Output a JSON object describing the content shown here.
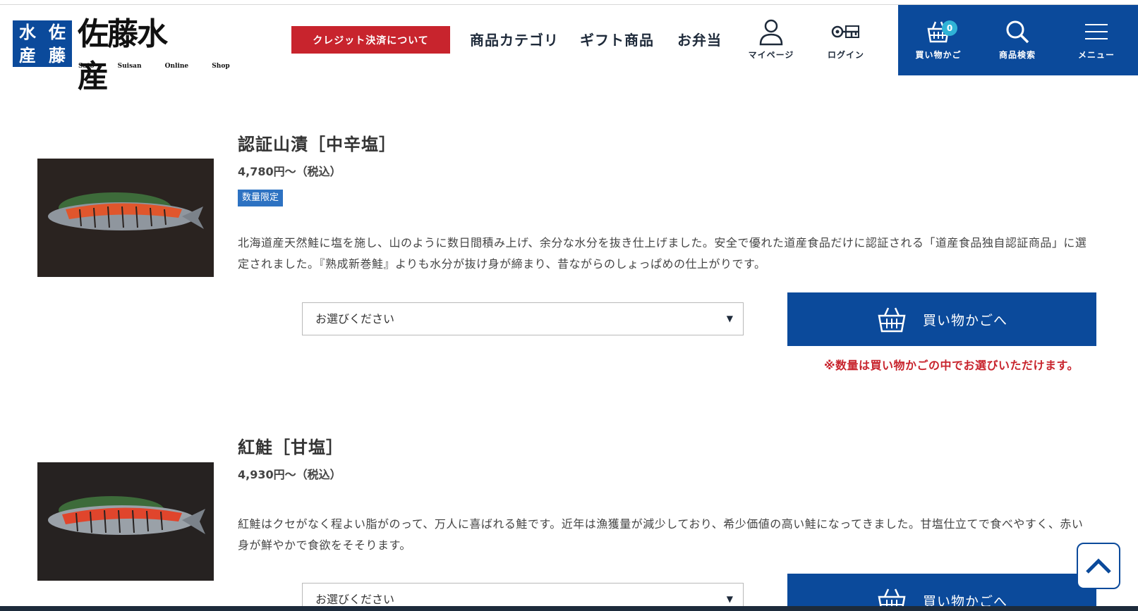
{
  "header": {
    "logo": {
      "mark_chars": [
        "水",
        "佐",
        "産",
        "藤"
      ],
      "script": "佐藤水産",
      "sub": "Sato Suisan Online Shop"
    },
    "credit_button": "クレジット決済について",
    "nav": [
      "商品カテゴリ",
      "ギフト商品",
      "お弁当"
    ],
    "icons": {
      "mypage": "マイページ",
      "login": "ログイン",
      "cart": "買い物かご",
      "cart_count": "0",
      "search": "商品検索",
      "menu": "メニュー"
    }
  },
  "products": [
    {
      "title": "認証山漬［中辛塩］",
      "price": "4,780円〜（税込）",
      "badge": "数量限定",
      "description": "北海道産天然鮭に塩を施し、山のように数日間積み上げ、余分な水分を抜き仕上げました。安全で優れた道産食品だけに認証される「道産食品独自認証商品」に選定されました。『熟成新巻鮭』よりも水分が抜け身が締まり、昔ながらのしょっぱめの仕上がりです。",
      "select_placeholder": "お選びください",
      "cart_button": "買い物かごへ",
      "note": "※数量は買い物かごの中でお選びいただけます。"
    },
    {
      "title": "紅鮭［甘塩］",
      "price": "4,930円〜（税込）",
      "description": "紅鮭はクセがなく程よい脂がのって、万人に喜ばれる鮭です。近年は漁獲量が減少しており、希少価値の高い鮭になってきました。甘塩仕立てで食べやすく、赤い身が鮮やかで食欲をそそります。",
      "select_placeholder": "お選びください",
      "cart_button": "買い物かごへ"
    }
  ],
  "colors": {
    "brand_blue": "#0b4a9b",
    "accent_red": "#c8242d",
    "badge_blue": "#2d72c2",
    "cart_badge": "#2fb3d6"
  }
}
